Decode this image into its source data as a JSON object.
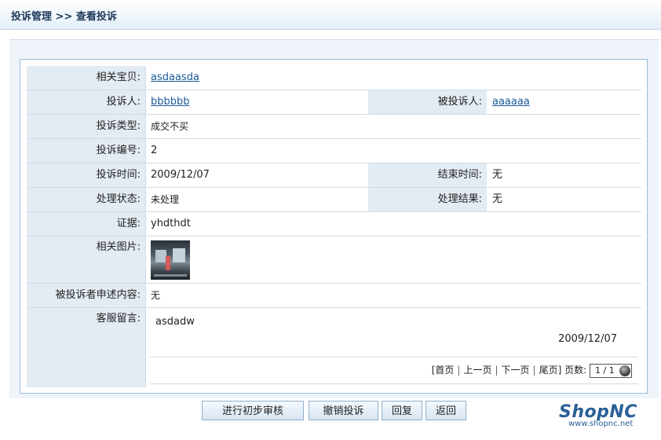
{
  "header": {
    "title": "投诉管理 >> 查看投诉"
  },
  "fields": {
    "item_label": "相关宝贝:",
    "item_value": "asdaasda",
    "complainant_label": "投诉人:",
    "complainant_value": "bbbbbb",
    "defendant_label": "被投诉人:",
    "defendant_value": "aaaaaa",
    "type_label": "投诉类型:",
    "type_value": "成交不买",
    "number_label": "投诉编号:",
    "number_value": "2",
    "time_label": "投诉时间:",
    "time_value": "2009/12/07",
    "end_label": "结束时间:",
    "end_value": "无",
    "status_label": "处理状态:",
    "status_value": "未处理",
    "result_label": "处理结果:",
    "result_value": "无",
    "evidence_label": "证据:",
    "evidence_value": "yhdthdt",
    "image_label": "相关图片:",
    "appeal_label": "被投诉者申述内容:",
    "appeal_value": "无",
    "service_label": "客服留言:"
  },
  "message": {
    "text": "asdadw",
    "date": "2009/12/07"
  },
  "pager": {
    "bracket_open": "[",
    "first": "首页",
    "prev": "上一页",
    "next": "下一页",
    "last": "尾页",
    "bracket_close": "]",
    "pages_label": "页数:",
    "page_value": "1 / 1"
  },
  "buttons": {
    "audit": "进行初步审核",
    "revoke": "撤销投诉",
    "reply": "回复",
    "back": "返回"
  },
  "logo": {
    "name": "ShopNC",
    "url": "www.shopnc.net"
  }
}
